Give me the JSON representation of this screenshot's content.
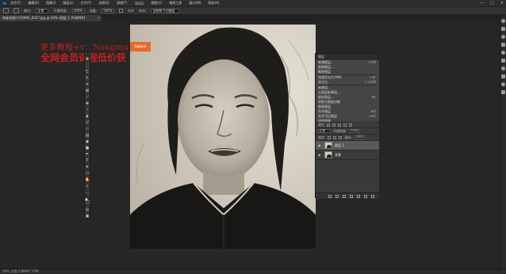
{
  "app": {
    "logo_text": "Ps",
    "menu": [
      "文件(F)",
      "编辑(E)",
      "图像(I)",
      "图层(L)",
      "文字(Y)",
      "选择(S)",
      "滤镜(T)",
      "3D(D)",
      "视图(V)",
      "增效工具",
      "窗口(W)",
      "帮助(H)"
    ],
    "window_controls": [
      "—",
      "□",
      "×"
    ]
  },
  "options_bar": {
    "mode_label": "模式:",
    "mode_value": "正常",
    "opacity_label": "不透明度:",
    "opacity_value": "100%",
    "flow_label": "流量:",
    "flow_value": "100%",
    "aligned_label": "对齐",
    "sample_label": "样本:",
    "sample_value": "当前和下方图层"
  },
  "document": {
    "tab_label": "修复老照片(2)/IMG_0327.jpg @ 50% (图层 1, RGB/8#)",
    "close_glyph": "×"
  },
  "watermark": {
    "line1": "更多教程+v：Nongmu",
    "line2": "全网会员课程低价获",
    "badge": "Space"
  },
  "toolbox": {
    "tools": [
      "move",
      "marquee",
      "lasso",
      "quick-select",
      "crop",
      "frame",
      "eyedropper",
      "healing",
      "brush",
      "stamp",
      "history-brush",
      "eraser",
      "gradient",
      "blur",
      "dodge",
      "pen",
      "type",
      "path-select",
      "shape",
      "hand",
      "zoom",
      "more"
    ]
  },
  "right_panel": {
    "title": "图层",
    "menu_items": [
      {
        "label": "新建图层...",
        "shortcut": "⇧⌘N"
      },
      {
        "label": "复制图层...",
        "shortcut": ""
      },
      {
        "label": "删除图层",
        "shortcut": ""
      },
      {
        "label": "快速导出为 PNG",
        "shortcut": "⇧⌘'"
      },
      {
        "label": "导出为...",
        "shortcut": "⌥⇧⌘W"
      },
      {
        "label": "新建组...",
        "shortcut": ""
      },
      {
        "label": "从图层新建组...",
        "shortcut": ""
      },
      {
        "label": "锁定图层...",
        "shortcut": "⌘/"
      },
      {
        "label": "转换为智能对象",
        "shortcut": ""
      },
      {
        "label": "链接图层",
        "shortcut": ""
      },
      {
        "label": "合并图层",
        "shortcut": "⌘E"
      },
      {
        "label": "合并可见图层",
        "shortcut": "⇧⌘E"
      },
      {
        "label": "拼合图像",
        "shortcut": ""
      }
    ],
    "kind_label": "类型",
    "blend_mode": "正常",
    "opacity_label": "不透明度:",
    "opacity_value": "100%",
    "lock_label": "锁定:",
    "fill_label": "填充:",
    "fill_value": "100%",
    "layers": [
      {
        "name": "图层 1",
        "selected": true
      },
      {
        "name": "背景",
        "selected": false
      }
    ]
  },
  "statusbar": {
    "text": "50%    文档:3.86M/7.73M"
  }
}
